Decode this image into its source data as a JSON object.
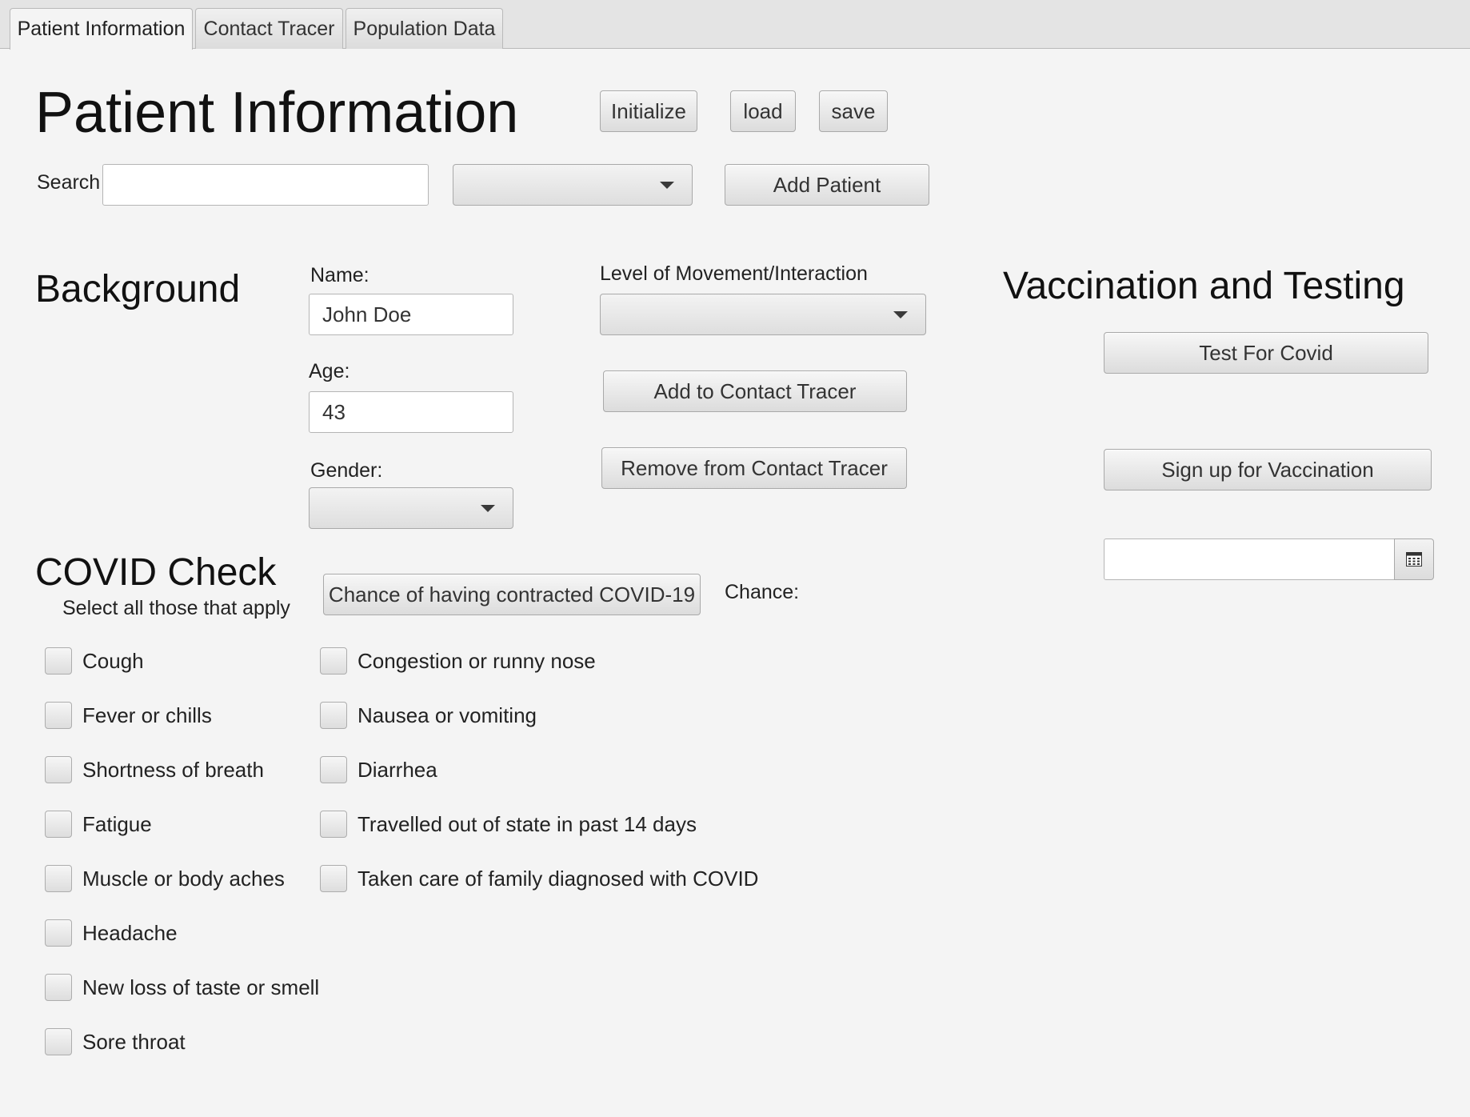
{
  "tabs": [
    {
      "label": "Patient Information",
      "active": true
    },
    {
      "label": "Contact Tracer",
      "active": false
    },
    {
      "label": "Population Data",
      "active": false
    }
  ],
  "header": {
    "title": "Patient Information",
    "initialize_label": "Initialize",
    "load_label": "load",
    "save_label": "save"
  },
  "search": {
    "label": "Search",
    "value": "",
    "filter_value": "",
    "add_patient_label": "Add Patient"
  },
  "background": {
    "heading": "Background",
    "name_label": "Name:",
    "name_value": "John Doe",
    "age_label": "Age:",
    "age_value": "43",
    "gender_label": "Gender:",
    "gender_value": "",
    "movement_label": "Level of Movement/Interaction",
    "movement_value": "",
    "add_tracer_label": "Add to Contact Tracer",
    "remove_tracer_label": "Remove from Contact Tracer"
  },
  "vaccination": {
    "heading": "Vaccination and Testing",
    "test_label": "Test For Covid",
    "signup_label": "Sign up for Vaccination",
    "date_value": "",
    "calendar_icon": "calendar-icon"
  },
  "covid": {
    "heading": "COVID Check",
    "subheading": "Select all those that apply",
    "chance_button_label": "Chance of having contracted COVID-19",
    "chance_label": "Chance:",
    "symptoms_left": [
      "Cough",
      "Fever or chills",
      "Shortness of breath",
      "Fatigue",
      "Muscle or body aches",
      "Headache",
      "New loss of taste or smell",
      "Sore throat"
    ],
    "symptoms_right": [
      "Congestion or runny nose",
      "Nausea or vomiting",
      "Diarrhea",
      "Travelled out of state in past 14 days",
      "Taken care of family diagnosed with COVID"
    ]
  }
}
